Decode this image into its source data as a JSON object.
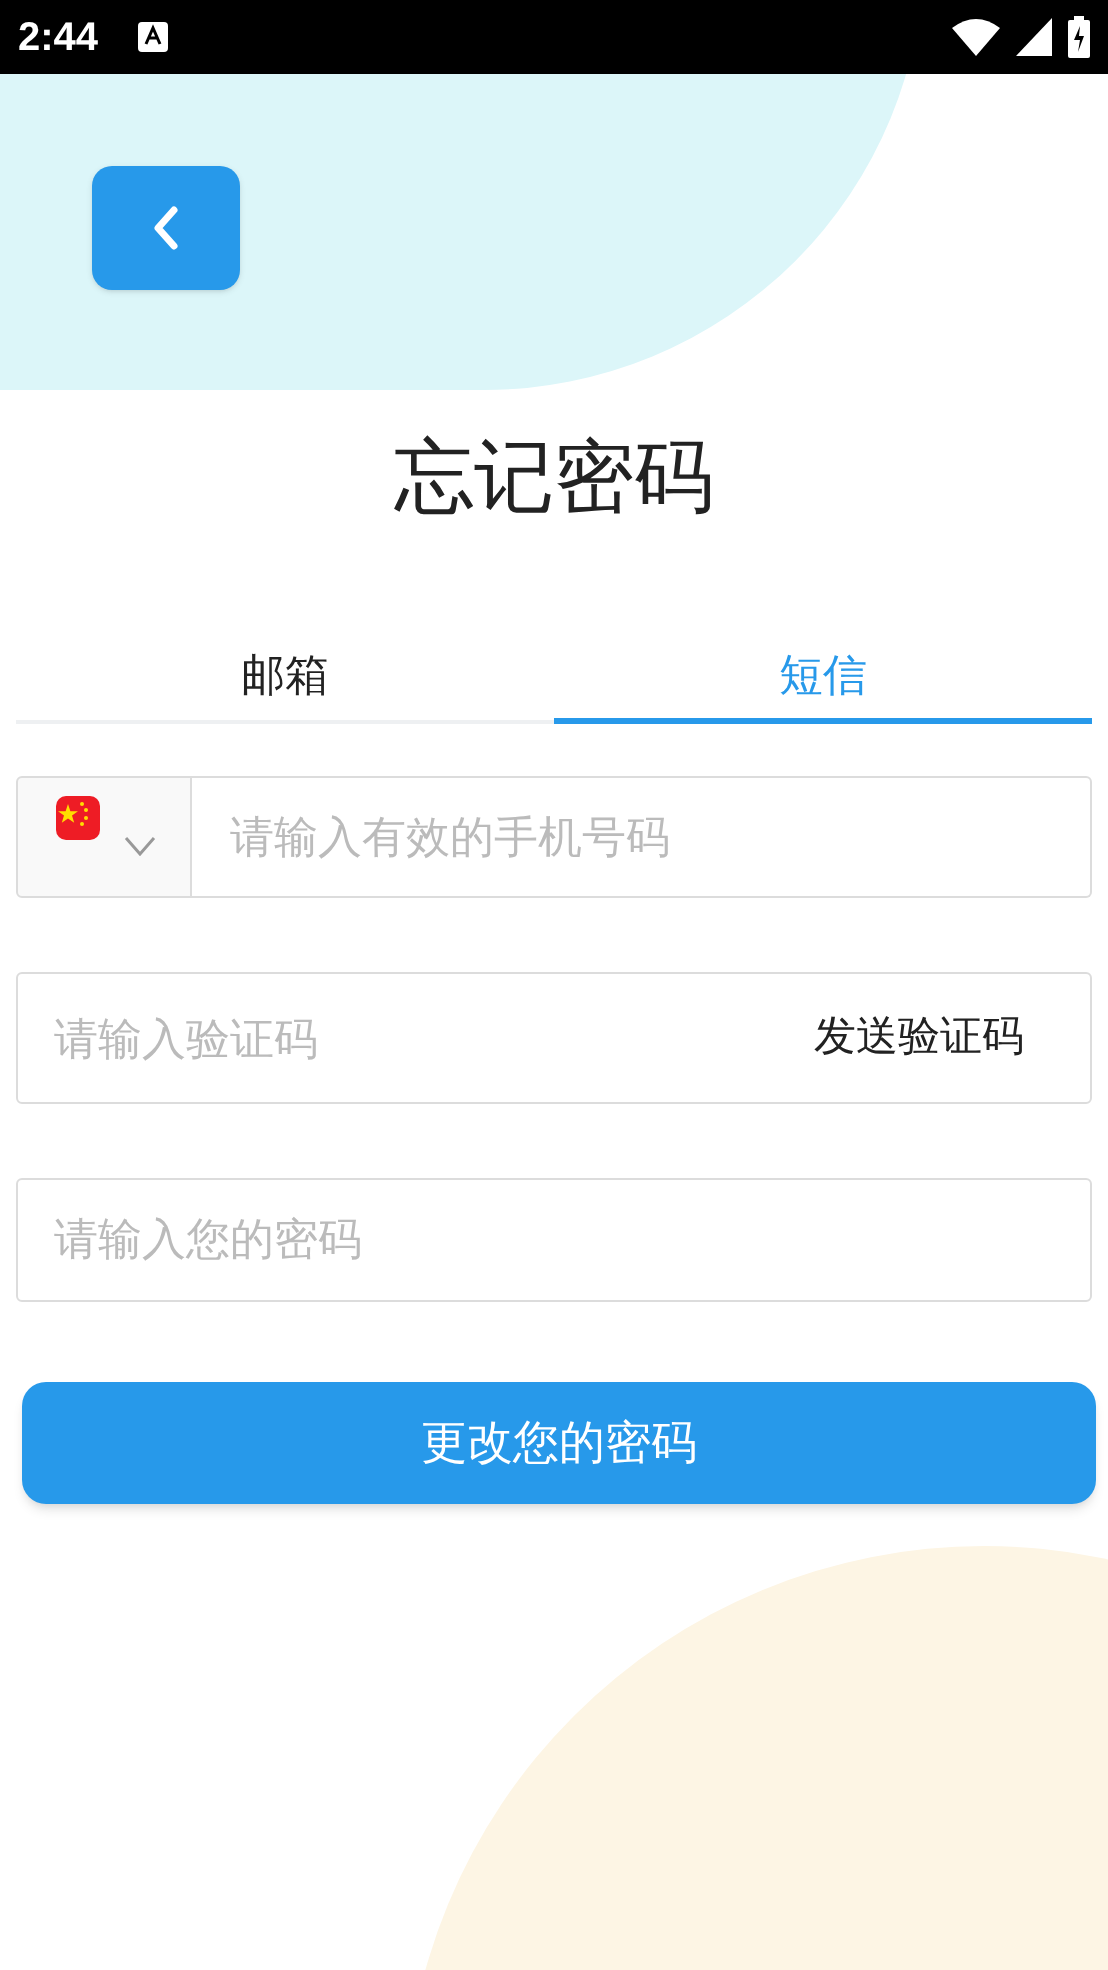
{
  "status_bar": {
    "time": "2:44"
  },
  "title": "忘记密码",
  "tabs": [
    {
      "label": "邮箱",
      "selected": false
    },
    {
      "label": "短信",
      "selected": true
    }
  ],
  "phone_field": {
    "placeholder": "请输入有效的手机号码"
  },
  "code_field": {
    "placeholder": "请输入验证码",
    "send_button": "发送验证码"
  },
  "password_field": {
    "placeholder": "请输入您的密码"
  },
  "submit_button": "更改您的密码"
}
